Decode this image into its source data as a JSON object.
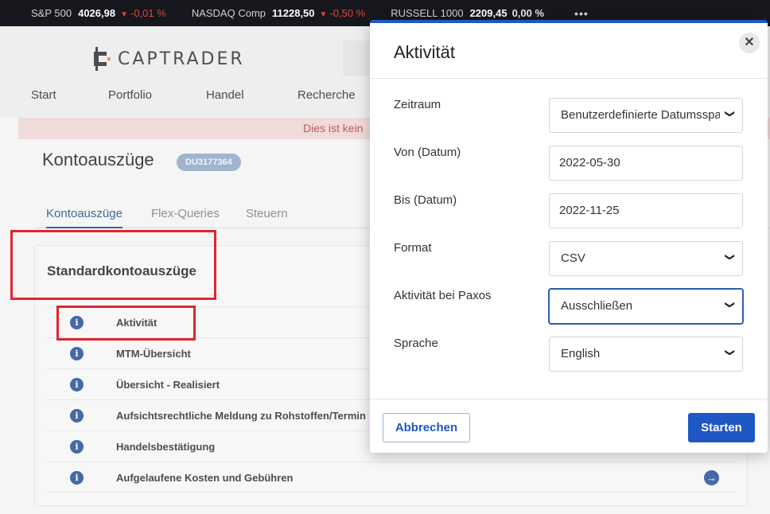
{
  "ticker": {
    "items": [
      {
        "name": "S&P 500",
        "value": "4026,98",
        "change": "-0,01 %",
        "direction": "down"
      },
      {
        "name": "NASDAQ Comp",
        "value": "11228,50",
        "change": "-0,50 %",
        "direction": "down"
      },
      {
        "name": "RUSSELL 1000",
        "value": "2209,45",
        "change": "0,00 %",
        "direction": "flat"
      }
    ],
    "more_icon": "more-dots-icon",
    "down_color": "#e2443a"
  },
  "header": {
    "logo_text": "CAPTRADER",
    "nav": [
      "Start",
      "Portfolio",
      "Handel",
      "Recherche"
    ]
  },
  "banner": {
    "text": "Dies ist kein"
  },
  "page": {
    "title": "Kontoauszüge",
    "account_id": "DU3177364",
    "tabs": [
      "Kontoauszüge",
      "Flex-Queries",
      "Steuern"
    ],
    "active_tab": 0,
    "panel_title": "Standardkontoauszüge",
    "statements": [
      "Aktivität",
      "MTM-Übersicht",
      "Übersicht - Realisiert",
      "Aufsichtsrechtliche Meldung zu Rohstoffen/Termin",
      "Handelsbestätigung",
      "Aufgelaufene Kosten und Gebühren"
    ],
    "info_icon": "info-icon",
    "go_icon": "arrow-right-circle-icon"
  },
  "modal": {
    "title": "Aktivität",
    "close_icon": "close-icon",
    "fields": [
      {
        "label": "Zeitraum",
        "value": "Benutzerdefinierte Datumsspanne",
        "type": "select"
      },
      {
        "label": "Von (Datum)",
        "value": "2022-05-30",
        "type": "input"
      },
      {
        "label": "Bis (Datum)",
        "value": "2022-11-25",
        "type": "input"
      },
      {
        "label": "Format",
        "value": "CSV",
        "type": "select"
      },
      {
        "label": "Aktivität bei Paxos",
        "value": "Ausschließen",
        "type": "select"
      },
      {
        "label": "Sprache",
        "value": "English",
        "type": "select"
      }
    ],
    "cancel_label": "Abbrechen",
    "start_label": "Starten",
    "accent": "#1f58c4"
  }
}
